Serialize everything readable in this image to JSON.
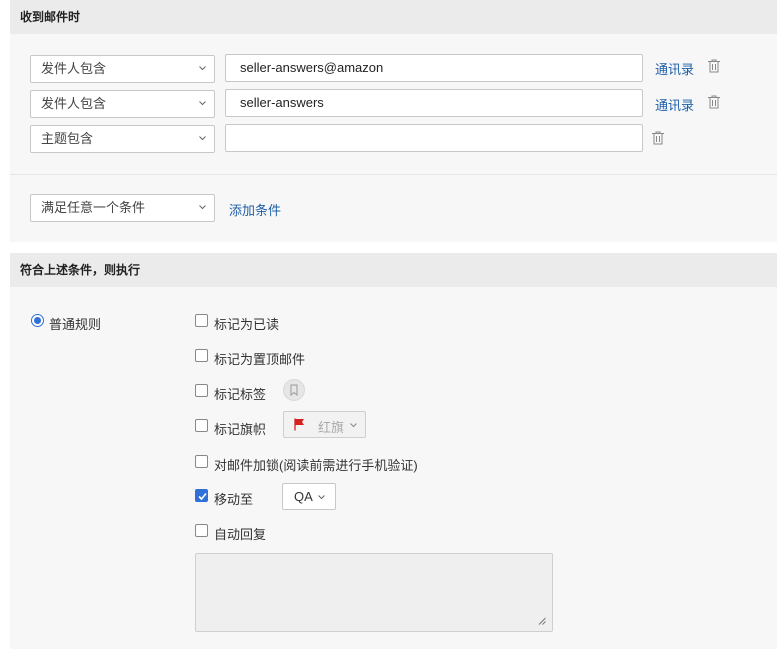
{
  "section1": {
    "title": "收到邮件时",
    "conditions": [
      {
        "field": "发件人包含",
        "value": "seller-answers@amazon",
        "contacts": "通讯录"
      },
      {
        "field": "发件人包含",
        "value": "seller-answers",
        "contacts": "通讯录"
      },
      {
        "field": "主题包含",
        "value": ""
      }
    ],
    "match_mode": "满足任意一个条件",
    "add_condition": "添加条件"
  },
  "section2": {
    "title": "符合上述条件，则执行",
    "rule_type": "普通规则",
    "actions": {
      "mark_read": "标记为已读",
      "mark_top": "标记为置顶邮件",
      "mark_tag": "标记标签",
      "mark_flag": "标记旗帜",
      "flag_value": "红旗",
      "lock": "对邮件加锁(阅读前需进行手机验证)",
      "move_to": "移动至",
      "move_folder": "QA",
      "auto_reply": "自动回复"
    }
  },
  "colors": {
    "accent": "#2f6fd8",
    "link": "#1f5fa8",
    "flag": "#d62020"
  }
}
